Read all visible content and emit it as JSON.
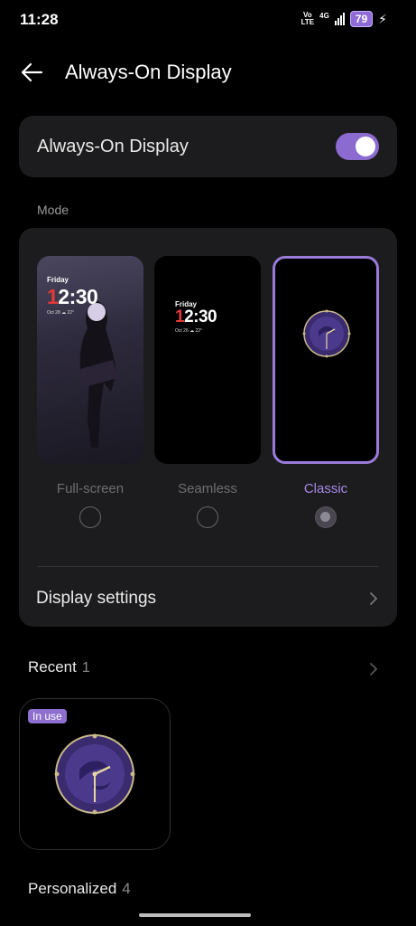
{
  "status_bar": {
    "time": "11:28",
    "volte_top": "Vo",
    "volte_bottom": "LTE",
    "network": "4G",
    "battery": "79",
    "charging_icon": "bolt-icon"
  },
  "header": {
    "back_icon": "back-arrow-icon",
    "title": "Always-On Display"
  },
  "toggle_card": {
    "label": "Always-On Display",
    "enabled": true
  },
  "mode_section": {
    "title": "Mode",
    "options": [
      {
        "label": "Full-screen",
        "selected": false,
        "preview": {
          "day": "Friday",
          "time_first": "1",
          "time_rest": "2:30",
          "date": "Oct 28  ☁ 22°"
        }
      },
      {
        "label": "Seamless",
        "selected": false,
        "preview": {
          "day": "Friday",
          "time_first": "1",
          "time_rest": "2:30",
          "date": "Oct 26  ☁ 22°"
        }
      },
      {
        "label": "Classic",
        "selected": true
      }
    ],
    "display_settings_label": "Display settings"
  },
  "recent": {
    "label": "Recent",
    "count": "1",
    "badge": "In use"
  },
  "personalized": {
    "label": "Personalized",
    "count": "4"
  },
  "colors": {
    "accent": "#8c6bd0",
    "card_bg": "#1c1c1e",
    "page_bg": "#000000"
  }
}
